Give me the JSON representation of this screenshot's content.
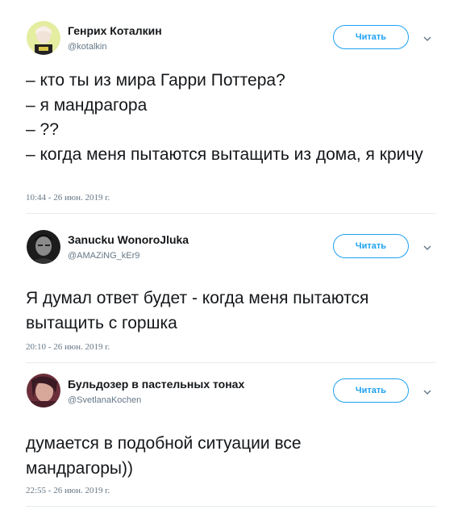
{
  "tweets": [
    {
      "name": "Генрих Коталкин",
      "handle": "@kotalkin",
      "follow_label": "Читать",
      "text": "– кто ты из мира Гарри Поттера?\n– я мандрагора\n– ??\n– когда меня пытаются вытащить из дома, я кричу",
      "timestamp": "10:44 - 26 июн. 2019 г."
    },
    {
      "name": "Зanucku WonoroJluka",
      "handle": "@AMAZiNG_kEr9",
      "follow_label": "Читать",
      "text": "Я думал ответ будет - когда меня пытаются вытащить с горшка",
      "timestamp": "20:10 - 26 июн. 2019 г."
    },
    {
      "name": "Бульдозер в пастельных тонах",
      "handle": "@SvetlanaKochen",
      "follow_label": "Читать",
      "text": "думается в подобной ситуации все мандрагоры))",
      "timestamp": "22:55 - 26 июн. 2019 г."
    }
  ],
  "icons": {
    "menu": "chevron-down-icon"
  },
  "colors": {
    "accent": "#1da1f2",
    "secondary_text": "#657786",
    "divider": "#e6ecf0"
  }
}
